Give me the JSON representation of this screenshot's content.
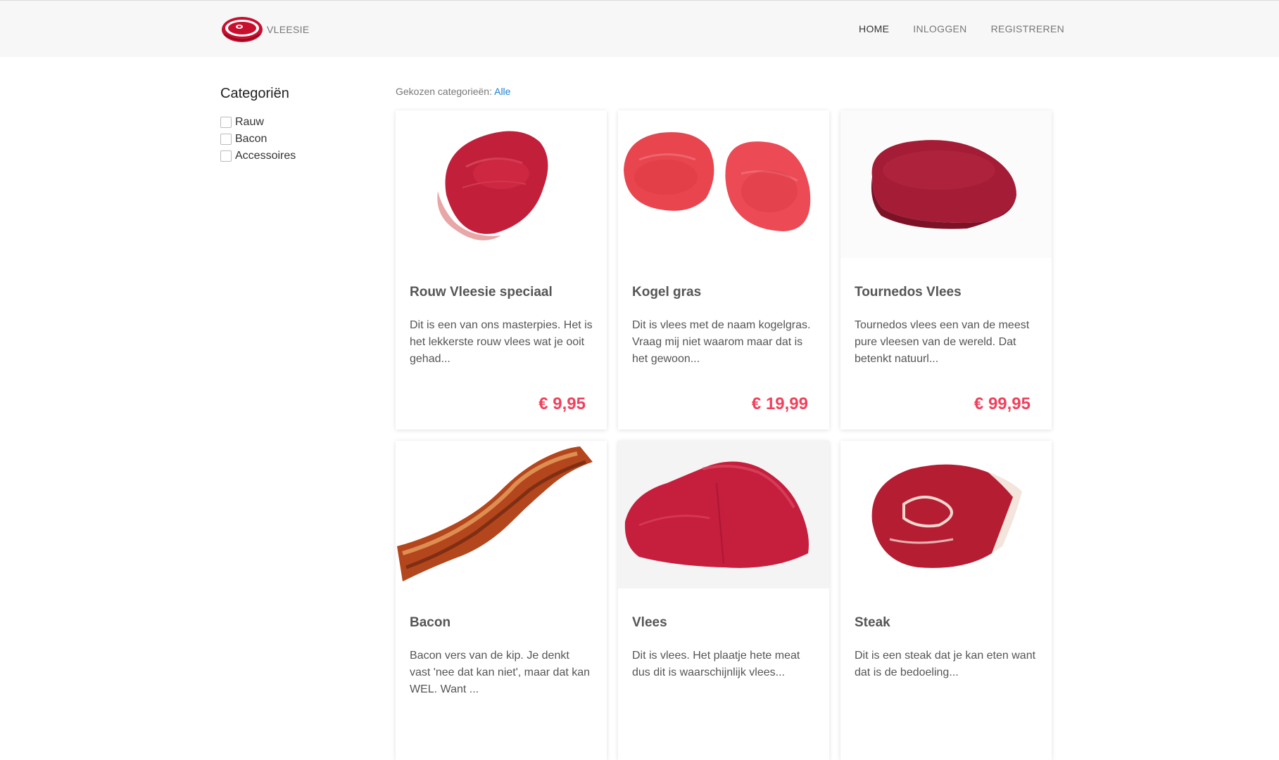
{
  "header": {
    "brand": "VLEESIE",
    "nav": [
      {
        "label": "HOME",
        "active": true
      },
      {
        "label": "INLOGGEN",
        "active": false
      },
      {
        "label": "REGISTREREN",
        "active": false
      }
    ]
  },
  "sidebar": {
    "title": "Categoriën",
    "categories": [
      {
        "label": "Rauw",
        "checked": false
      },
      {
        "label": "Bacon",
        "checked": false
      },
      {
        "label": "Accessoires",
        "checked": false
      }
    ]
  },
  "filter": {
    "label": "Gekozen categorieën:",
    "value": "Alle"
  },
  "colors": {
    "price": "#f0415c",
    "link": "#1a7fd4",
    "header_bg": "#f7f7f7"
  },
  "products": [
    {
      "title": "Rouw Vleesie speciaal",
      "description": "Dit is een van ons masterpies. Het is het lekkerste rouw vlees wat je ooit gehad...",
      "price": "€ 9,95",
      "image": "raw-steak"
    },
    {
      "title": "Kogel gras",
      "description": "Dit is vlees met de naam kogelgras. Vraag mij niet waarom maar dat is het gewoon...",
      "price": "€ 19,99",
      "image": "two-steaks"
    },
    {
      "title": "Tournedos Vlees",
      "description": "Tournedos vlees een van de meest pure vleesen van de wereld. Dat betenkt natuurl...",
      "price": "€ 99,95",
      "image": "tournedos"
    },
    {
      "title": "Bacon",
      "description": "Bacon vers van de kip. Je denkt vast 'nee dat kan niet', maar dat kan WEL. Want ...",
      "price": "",
      "image": "bacon-strip"
    },
    {
      "title": "Vlees",
      "description": "Dit is vlees. Het plaatje hete meat dus dit is waarschijnlijk vlees...",
      "price": "",
      "image": "meat-chunk"
    },
    {
      "title": "Steak",
      "description": "Dit is een steak dat je kan eten want dat is de bedoeling...",
      "price": "",
      "image": "ribeye-steak"
    }
  ]
}
